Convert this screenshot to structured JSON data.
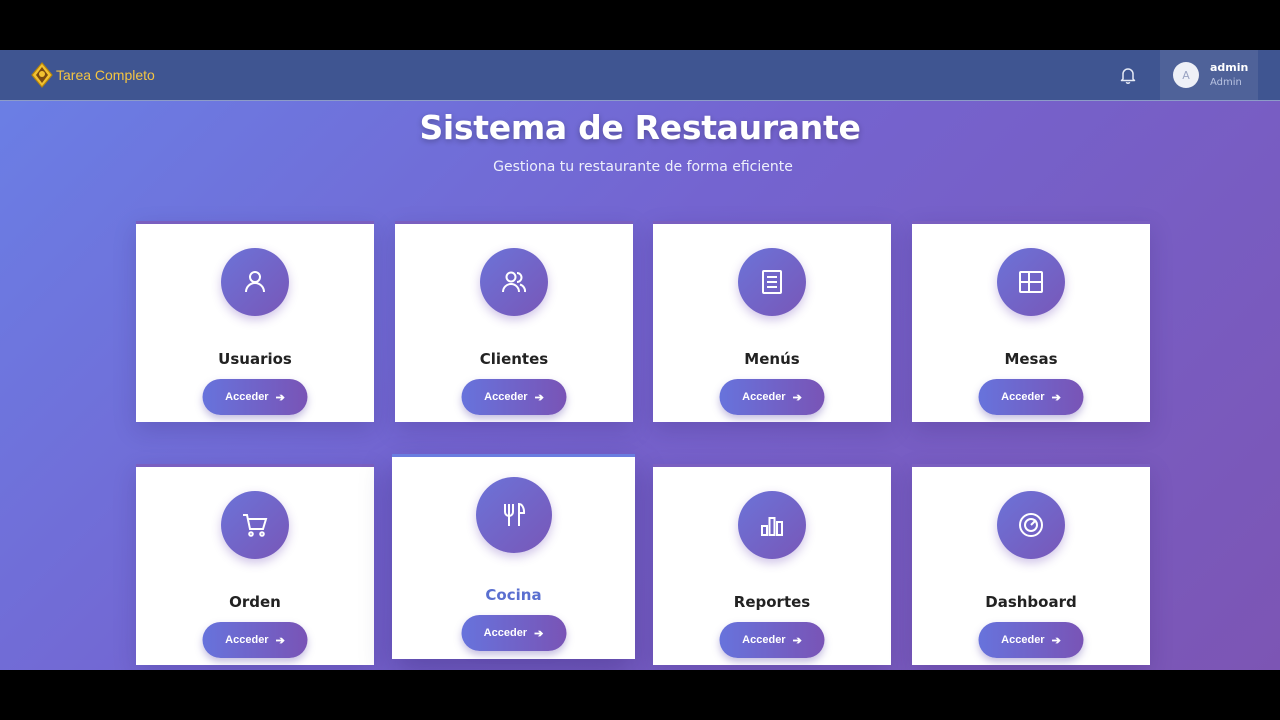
{
  "navbar": {
    "brand_name": "Tarea Completo",
    "user_initial": "A",
    "user_name": "admin",
    "user_role": "Admin"
  },
  "hero": {
    "title": "Sistema de Restaurante",
    "subtitle": "Gestiona tu restaurante de forma eficiente"
  },
  "modules": [
    {
      "label": "Usuarios",
      "button": "Acceder",
      "icon": "user-icon"
    },
    {
      "label": "Clientes",
      "button": "Acceder",
      "icon": "users-icon"
    },
    {
      "label": "Menús",
      "button": "Acceder",
      "icon": "menu-list-icon"
    },
    {
      "label": "Mesas",
      "button": "Acceder",
      "icon": "table-layout-icon"
    },
    {
      "label": "Orden",
      "button": "Acceder",
      "icon": "cart-icon"
    },
    {
      "label": "Cocina",
      "button": "Acceder",
      "icon": "fork-knife-icon"
    },
    {
      "label": "Reportes",
      "button": "Acceder",
      "icon": "bar-chart-icon"
    },
    {
      "label": "Dashboard",
      "button": "Acceder",
      "icon": "gauge-icon"
    }
  ],
  "colors": {
    "navbar": "#3f5591",
    "accent_start": "#6773dc",
    "accent_end": "#7954b6",
    "brand_text": "#f4c542",
    "active_label": "#5a6fd0"
  }
}
